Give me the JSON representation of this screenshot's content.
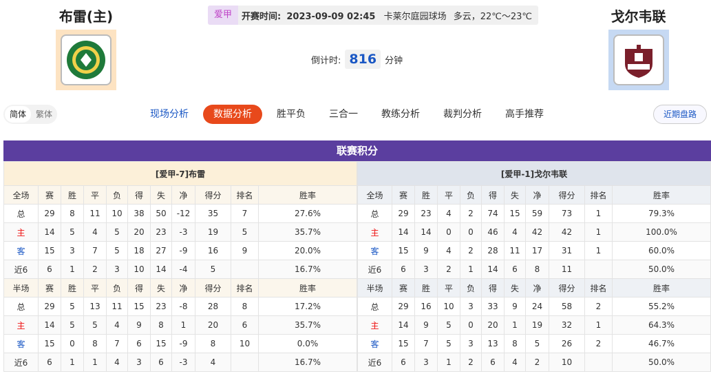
{
  "home": {
    "name": "布雷(主)",
    "logo_text": "BRAY WANDERERS"
  },
  "away": {
    "name": "戈尔韦联",
    "logo_text": "GALWAY UNITED"
  },
  "match": {
    "league": "爱甲",
    "time_label": "开赛时间:",
    "time_value": "2023-09-09 02:45",
    "venue": "卡莱尔庭园球场",
    "weather": "多云，22℃～23℃",
    "countdown_label": "倒计时:",
    "countdown_value": "816",
    "countdown_unit": "分钟"
  },
  "lang": {
    "simplified": "简体",
    "traditional": "繁体"
  },
  "nav": [
    "现场分析",
    "数据分析",
    "胜平负",
    "三合一",
    "教练分析",
    "裁判分析",
    "高手推荐"
  ],
  "recent_label": "近期盘路",
  "section_title": "联赛积分",
  "home_table": {
    "title": "[爱甲-7]布雷",
    "full_header": [
      "全场",
      "赛",
      "胜",
      "平",
      "负",
      "得",
      "失",
      "净",
      "得分",
      "排名",
      "胜率"
    ],
    "full_rows": [
      [
        "总",
        "29",
        "8",
        "11",
        "10",
        "38",
        "50",
        "-12",
        "35",
        "7",
        "27.6%"
      ],
      [
        "主",
        "14",
        "5",
        "4",
        "5",
        "20",
        "23",
        "-3",
        "19",
        "5",
        "35.7%"
      ],
      [
        "客",
        "15",
        "3",
        "7",
        "5",
        "18",
        "27",
        "-9",
        "16",
        "9",
        "20.0%"
      ],
      [
        "近6",
        "6",
        "1",
        "2",
        "3",
        "10",
        "14",
        "-4",
        "5",
        "",
        "16.7%"
      ]
    ],
    "half_header": [
      "半场",
      "赛",
      "胜",
      "平",
      "负",
      "得",
      "失",
      "净",
      "得分",
      "排名",
      "胜率"
    ],
    "half_rows": [
      [
        "总",
        "29",
        "5",
        "13",
        "11",
        "15",
        "23",
        "-8",
        "28",
        "8",
        "17.2%"
      ],
      [
        "主",
        "14",
        "5",
        "5",
        "4",
        "9",
        "8",
        "1",
        "20",
        "6",
        "35.7%"
      ],
      [
        "客",
        "15",
        "0",
        "8",
        "7",
        "6",
        "15",
        "-9",
        "8",
        "10",
        "0.0%"
      ],
      [
        "近6",
        "6",
        "1",
        "1",
        "4",
        "3",
        "6",
        "-3",
        "4",
        "",
        "16.7%"
      ]
    ]
  },
  "away_table": {
    "title": "[爱甲-1]戈尔韦联",
    "full_header": [
      "全场",
      "赛",
      "胜",
      "平",
      "负",
      "得",
      "失",
      "净",
      "得分",
      "排名",
      "胜率"
    ],
    "full_rows": [
      [
        "总",
        "29",
        "23",
        "4",
        "2",
        "74",
        "15",
        "59",
        "73",
        "1",
        "79.3%"
      ],
      [
        "主",
        "14",
        "14",
        "0",
        "0",
        "46",
        "4",
        "42",
        "42",
        "1",
        "100.0%"
      ],
      [
        "客",
        "15",
        "9",
        "4",
        "2",
        "28",
        "11",
        "17",
        "31",
        "1",
        "60.0%"
      ],
      [
        "近6",
        "6",
        "3",
        "2",
        "1",
        "14",
        "6",
        "8",
        "11",
        "",
        "50.0%"
      ]
    ],
    "half_header": [
      "半场",
      "赛",
      "胜",
      "平",
      "负",
      "得",
      "失",
      "净",
      "得分",
      "排名",
      "胜率"
    ],
    "half_rows": [
      [
        "总",
        "29",
        "16",
        "10",
        "3",
        "33",
        "9",
        "24",
        "58",
        "2",
        "55.2%"
      ],
      [
        "主",
        "14",
        "9",
        "5",
        "0",
        "20",
        "1",
        "19",
        "32",
        "1",
        "64.3%"
      ],
      [
        "客",
        "15",
        "7",
        "5",
        "3",
        "13",
        "8",
        "5",
        "26",
        "2",
        "46.7%"
      ],
      [
        "近6",
        "6",
        "3",
        "1",
        "2",
        "6",
        "4",
        "2",
        "10",
        "",
        "50.0%"
      ]
    ]
  }
}
